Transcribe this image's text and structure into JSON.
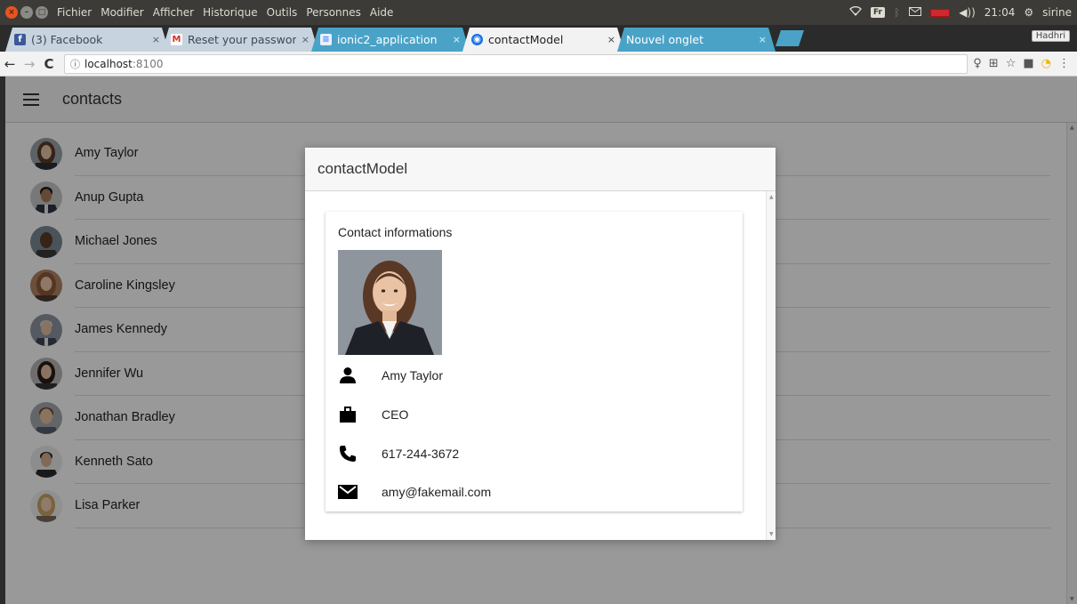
{
  "os": {
    "menu": [
      "Fichier",
      "Modifier",
      "Afficher",
      "Historique",
      "Outils",
      "Personnes",
      "Aide"
    ],
    "keyboard": "Fr",
    "time": "21:04",
    "user": "sirine"
  },
  "browser": {
    "tabs": [
      {
        "title": "(3) Facebook",
        "icon": "facebook-icon"
      },
      {
        "title": "Reset your password",
        "icon": "gmail-icon"
      },
      {
        "title": "ionic2_application",
        "icon": "docs-icon"
      },
      {
        "title": "contactModel",
        "icon": "chrome-icon"
      },
      {
        "title": "Nouvel onglet",
        "icon": ""
      }
    ],
    "profile": "Hadhri",
    "url_host": "localhost",
    "url_port": ":8100"
  },
  "app": {
    "title": "contacts",
    "contacts": [
      {
        "name": "Amy Taylor"
      },
      {
        "name": "Anup Gupta"
      },
      {
        "name": "Michael Jones"
      },
      {
        "name": "Caroline Kingsley"
      },
      {
        "name": "James Kennedy"
      },
      {
        "name": "Jennifer Wu"
      },
      {
        "name": "Jonathan Bradley"
      },
      {
        "name": "Kenneth Sato"
      },
      {
        "name": "Lisa Parker"
      }
    ]
  },
  "modal": {
    "title": "contactModel",
    "card_title": "Contact informations",
    "name": "Amy Taylor",
    "job": "CEO",
    "phone": "617-244-3672",
    "email": "amy@fakemail.com"
  },
  "colors": {
    "os_panel": "#3c3b37",
    "tab_blue": "#4aa3c7",
    "header_bg": "#f7f7f7"
  }
}
